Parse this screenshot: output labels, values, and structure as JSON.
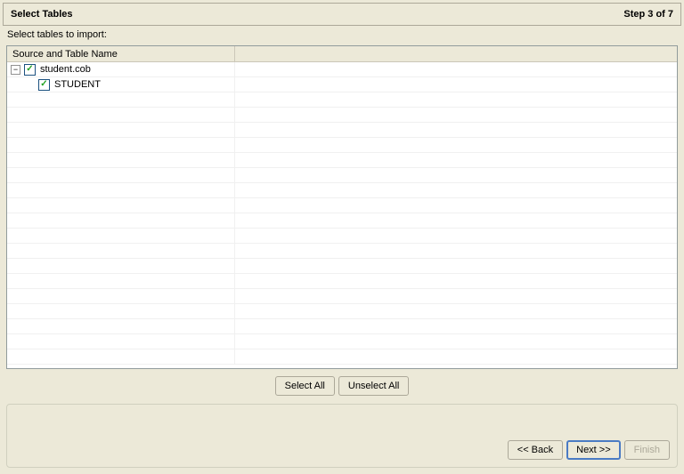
{
  "header": {
    "title": "Select Tables",
    "step": "Step 3 of 7"
  },
  "instruction": "Select tables to import:",
  "columns": {
    "col1": "Source and Table Name",
    "col2": ""
  },
  "tree": {
    "parent": {
      "label": "student.cob",
      "expanded": true,
      "checked": true
    },
    "child": {
      "label": "STUDENT",
      "checked": true
    }
  },
  "buttons": {
    "selectAll": "Select All",
    "unselectAll": "Unselect All",
    "back": "<< Back",
    "next": "Next >>",
    "finish": "Finish"
  },
  "expandSymbol": "−"
}
